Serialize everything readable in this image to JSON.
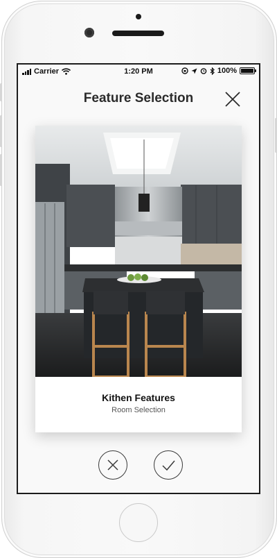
{
  "status_bar": {
    "carrier": "Carrier",
    "time": "1:20 PM",
    "battery": "100%",
    "battery_level": 1.0
  },
  "header": {
    "title": "Feature Selection",
    "close_icon": "close-icon"
  },
  "card": {
    "title": "Kithen Features",
    "subtitle": "Room Selection",
    "image": "kitchen-photo"
  },
  "actions": {
    "reject_icon": "x-circle-icon",
    "accept_icon": "checkmark-circle-icon"
  },
  "colors": {
    "text_dark": "#2b2b2b",
    "screen_bg": "#f9f9f9",
    "card_bg": "#ffffff"
  }
}
